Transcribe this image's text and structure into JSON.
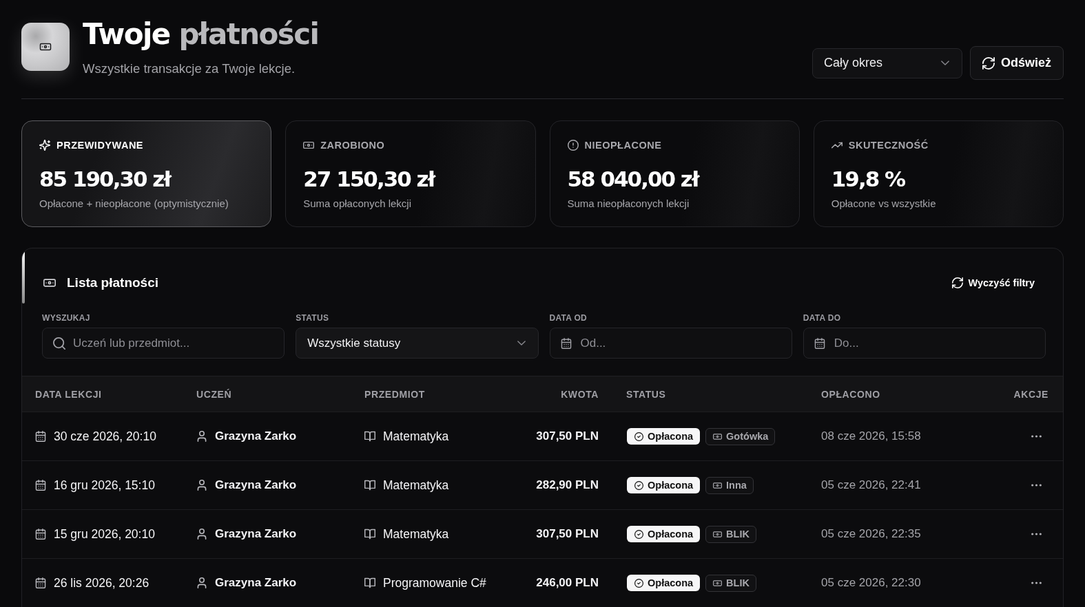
{
  "header": {
    "title_parts": [
      {
        "text": "Twoje",
        "kind": "plain"
      },
      {
        "text": "płatności",
        "kind": "accent"
      }
    ],
    "subtitle": "Wszystkie transakcje za Twoje lekcje.",
    "period_select": {
      "value": "Cały okres"
    },
    "refresh_button": "Odśwież"
  },
  "stats": [
    {
      "label": "PRZEWIDYWANE",
      "value": "85 190,30 zł",
      "caption": "Opłacone + nieopłacone (optymistycznie)",
      "selected": true
    },
    {
      "label": "ZAROBIONO",
      "value": "27 150,30 zł",
      "caption": "Suma opłaconych lekcji",
      "selected": false
    },
    {
      "label": "NIEOPŁACONE",
      "value": "58 040,00 zł",
      "caption": "Suma nieopłaconych lekcji",
      "selected": false
    },
    {
      "label": "SKUTECZNOŚĆ",
      "value": "19,8 %",
      "caption": "Opłacone vs wszystkie",
      "selected": false
    }
  ],
  "payments_panel": {
    "title": "Lista płatności",
    "clear_filters_button": "Wyczyść filtry",
    "filters": [
      {
        "label": "WYSZUKAJ",
        "kind": "search",
        "placeholder": "Uczeń lub przedmiot..."
      },
      {
        "label": "STATUS",
        "kind": "select",
        "value": "Wszystkie statusy"
      },
      {
        "label": "DATA OD",
        "kind": "date",
        "placeholder": "Od..."
      },
      {
        "label": "DATA DO",
        "kind": "date",
        "placeholder": "Do..."
      }
    ],
    "table": {
      "columns": [
        "DATA LEKCJI",
        "UCZEŃ",
        "PRZEDMIOT",
        "KWOTA",
        "STATUS",
        "OPŁACONO",
        "AKCJE"
      ],
      "rows": [
        {
          "lesson_date": "30 cze 2026, 20:10",
          "student": "Grazyna Zarko",
          "subject": "Matematyka",
          "amount": "307,50 PLN",
          "status": "Opłacona",
          "payment_method": "Gotówka",
          "paid_at": "08 cze 2026, 15:58"
        },
        {
          "lesson_date": "16 gru 2026, 15:10",
          "student": "Grazyna Zarko",
          "subject": "Matematyka",
          "amount": "282,90 PLN",
          "status": "Opłacona",
          "payment_method": "Inna",
          "paid_at": "05 cze 2026, 22:41"
        },
        {
          "lesson_date": "15 gru 2026, 20:10",
          "student": "Grazyna Zarko",
          "subject": "Matematyka",
          "amount": "307,50 PLN",
          "status": "Opłacona",
          "payment_method": "BLIK",
          "paid_at": "05 cze 2026, 22:35"
        },
        {
          "lesson_date": "26 lis 2026, 20:26",
          "student": "Grazyna Zarko",
          "subject": "Programowanie C#",
          "amount": "246,00 PLN",
          "status": "Opłacona",
          "payment_method": "BLIK",
          "paid_at": "05 cze 2026, 22:30"
        }
      ]
    }
  }
}
